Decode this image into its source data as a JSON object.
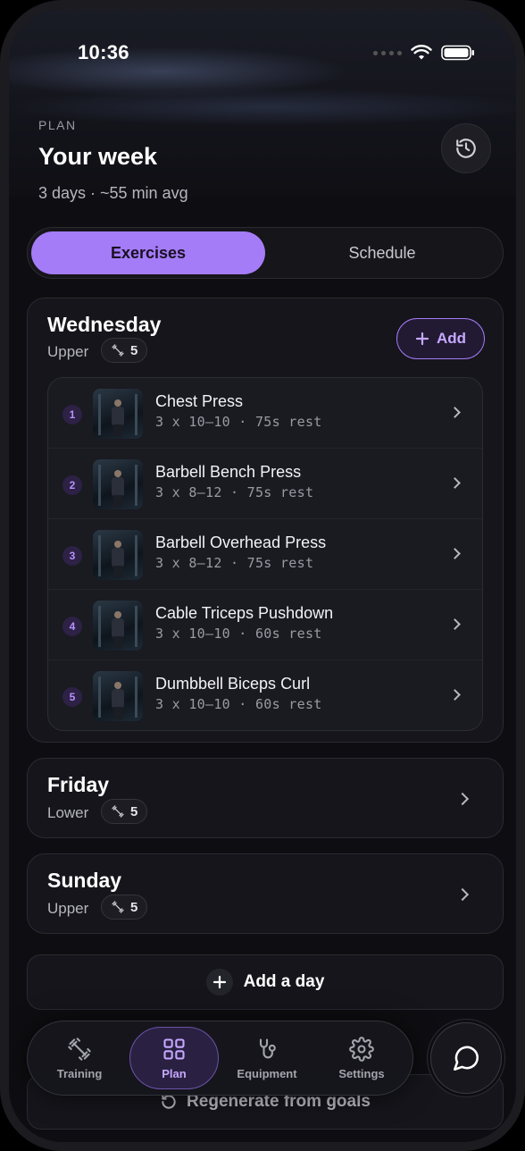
{
  "status_bar": {
    "time": "10:36"
  },
  "header": {
    "section_label": "PLAN",
    "title": "Your week",
    "subtitle": "3 days · ~55 min avg"
  },
  "tabs": [
    {
      "label": "Exercises",
      "active": true
    },
    {
      "label": "Schedule",
      "active": false
    }
  ],
  "days": [
    {
      "name": "Wednesday",
      "type": "Upper",
      "count": "5",
      "add_label": "Add",
      "expanded": true,
      "exercises": [
        {
          "num": "1",
          "name": "Chest Press",
          "meta": "3 x 10–10 · 75s rest"
        },
        {
          "num": "2",
          "name": "Barbell Bench Press",
          "meta": "3 x 8–12 · 75s rest"
        },
        {
          "num": "3",
          "name": "Barbell Overhead Press",
          "meta": "3 x 8–12 · 75s rest"
        },
        {
          "num": "4",
          "name": "Cable Triceps Pushdown",
          "meta": "3 x 10–10 · 60s rest"
        },
        {
          "num": "5",
          "name": "Dumbbell Biceps Curl",
          "meta": "3 x 10–10 · 60s rest"
        }
      ]
    },
    {
      "name": "Friday",
      "type": "Lower",
      "count": "5",
      "expanded": false
    },
    {
      "name": "Sunday",
      "type": "Upper",
      "count": "5",
      "expanded": false
    }
  ],
  "add_day_label": "Add a day",
  "regenerate_label": "Regenerate from goals",
  "nav": [
    {
      "label": "Training",
      "icon": "dumbbell-icon",
      "active": false
    },
    {
      "label": "Plan",
      "icon": "grid-icon",
      "active": true
    },
    {
      "label": "Equipment",
      "icon": "equipment-icon",
      "active": false
    },
    {
      "label": "Settings",
      "icon": "gear-icon",
      "active": false
    }
  ],
  "colors": {
    "accent": "#a47cf7",
    "background": "#0e0e12",
    "card": "#15151b"
  }
}
